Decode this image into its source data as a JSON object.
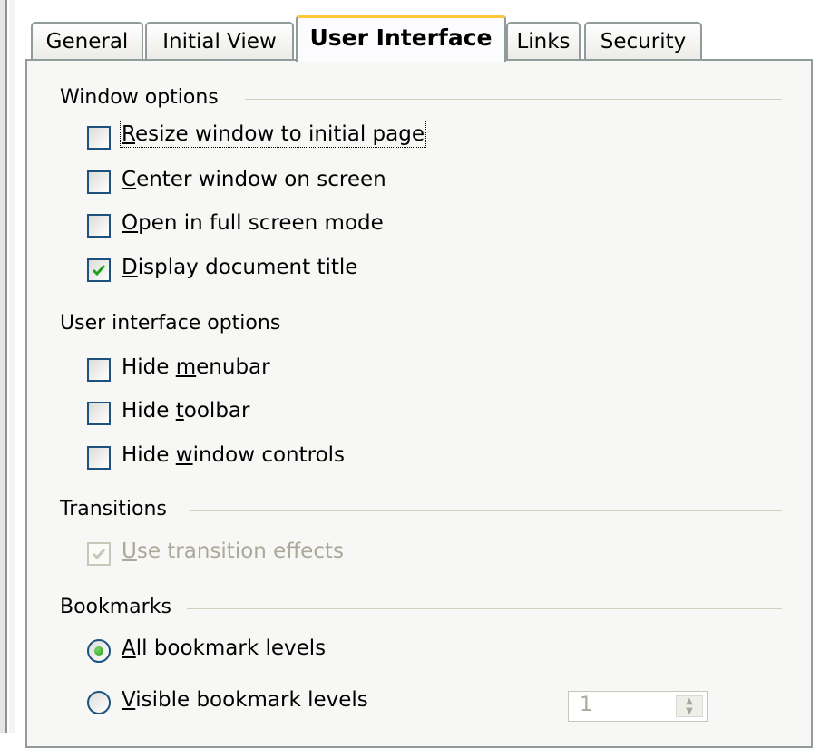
{
  "tabs": [
    {
      "label": "General"
    },
    {
      "label": "Initial View"
    },
    {
      "label": "User Interface",
      "active": true
    },
    {
      "label": "Links"
    },
    {
      "label": "Security"
    }
  ],
  "window_options": {
    "title": "Window options",
    "items": [
      {
        "label": "Resize window to initial page",
        "mnemonic": "R",
        "checked": false
      },
      {
        "label": "Center window on screen",
        "mnemonic": "C",
        "checked": false
      },
      {
        "label": "Open in full screen mode",
        "mnemonic": "O",
        "checked": false
      },
      {
        "label": "Display document title",
        "mnemonic": "D",
        "checked": true
      }
    ]
  },
  "ui_options": {
    "title": "User interface options",
    "items": [
      {
        "label": "Hide menubar",
        "mnemonic": "m",
        "checked": false
      },
      {
        "label": "Hide toolbar",
        "mnemonic": "t",
        "checked": false
      },
      {
        "label": "Hide window controls",
        "mnemonic": "w",
        "checked": false
      }
    ]
  },
  "transitions": {
    "title": "Transitions",
    "items": [
      {
        "label": "Use transition effects",
        "mnemonic": "U",
        "checked": true,
        "disabled": true
      }
    ]
  },
  "bookmarks": {
    "title": "Bookmarks",
    "options": [
      {
        "label": "All bookmark levels",
        "mnemonic": "A",
        "selected": true
      },
      {
        "label": "Visible bookmark levels",
        "mnemonic": "V",
        "selected": false
      }
    ],
    "levels_value": "1"
  },
  "colors": {
    "checkmark": "#21a121",
    "checkmark_disabled": "#c9c7ba",
    "active_tab_accent": "#ffc83c",
    "border": "#919b9c"
  }
}
